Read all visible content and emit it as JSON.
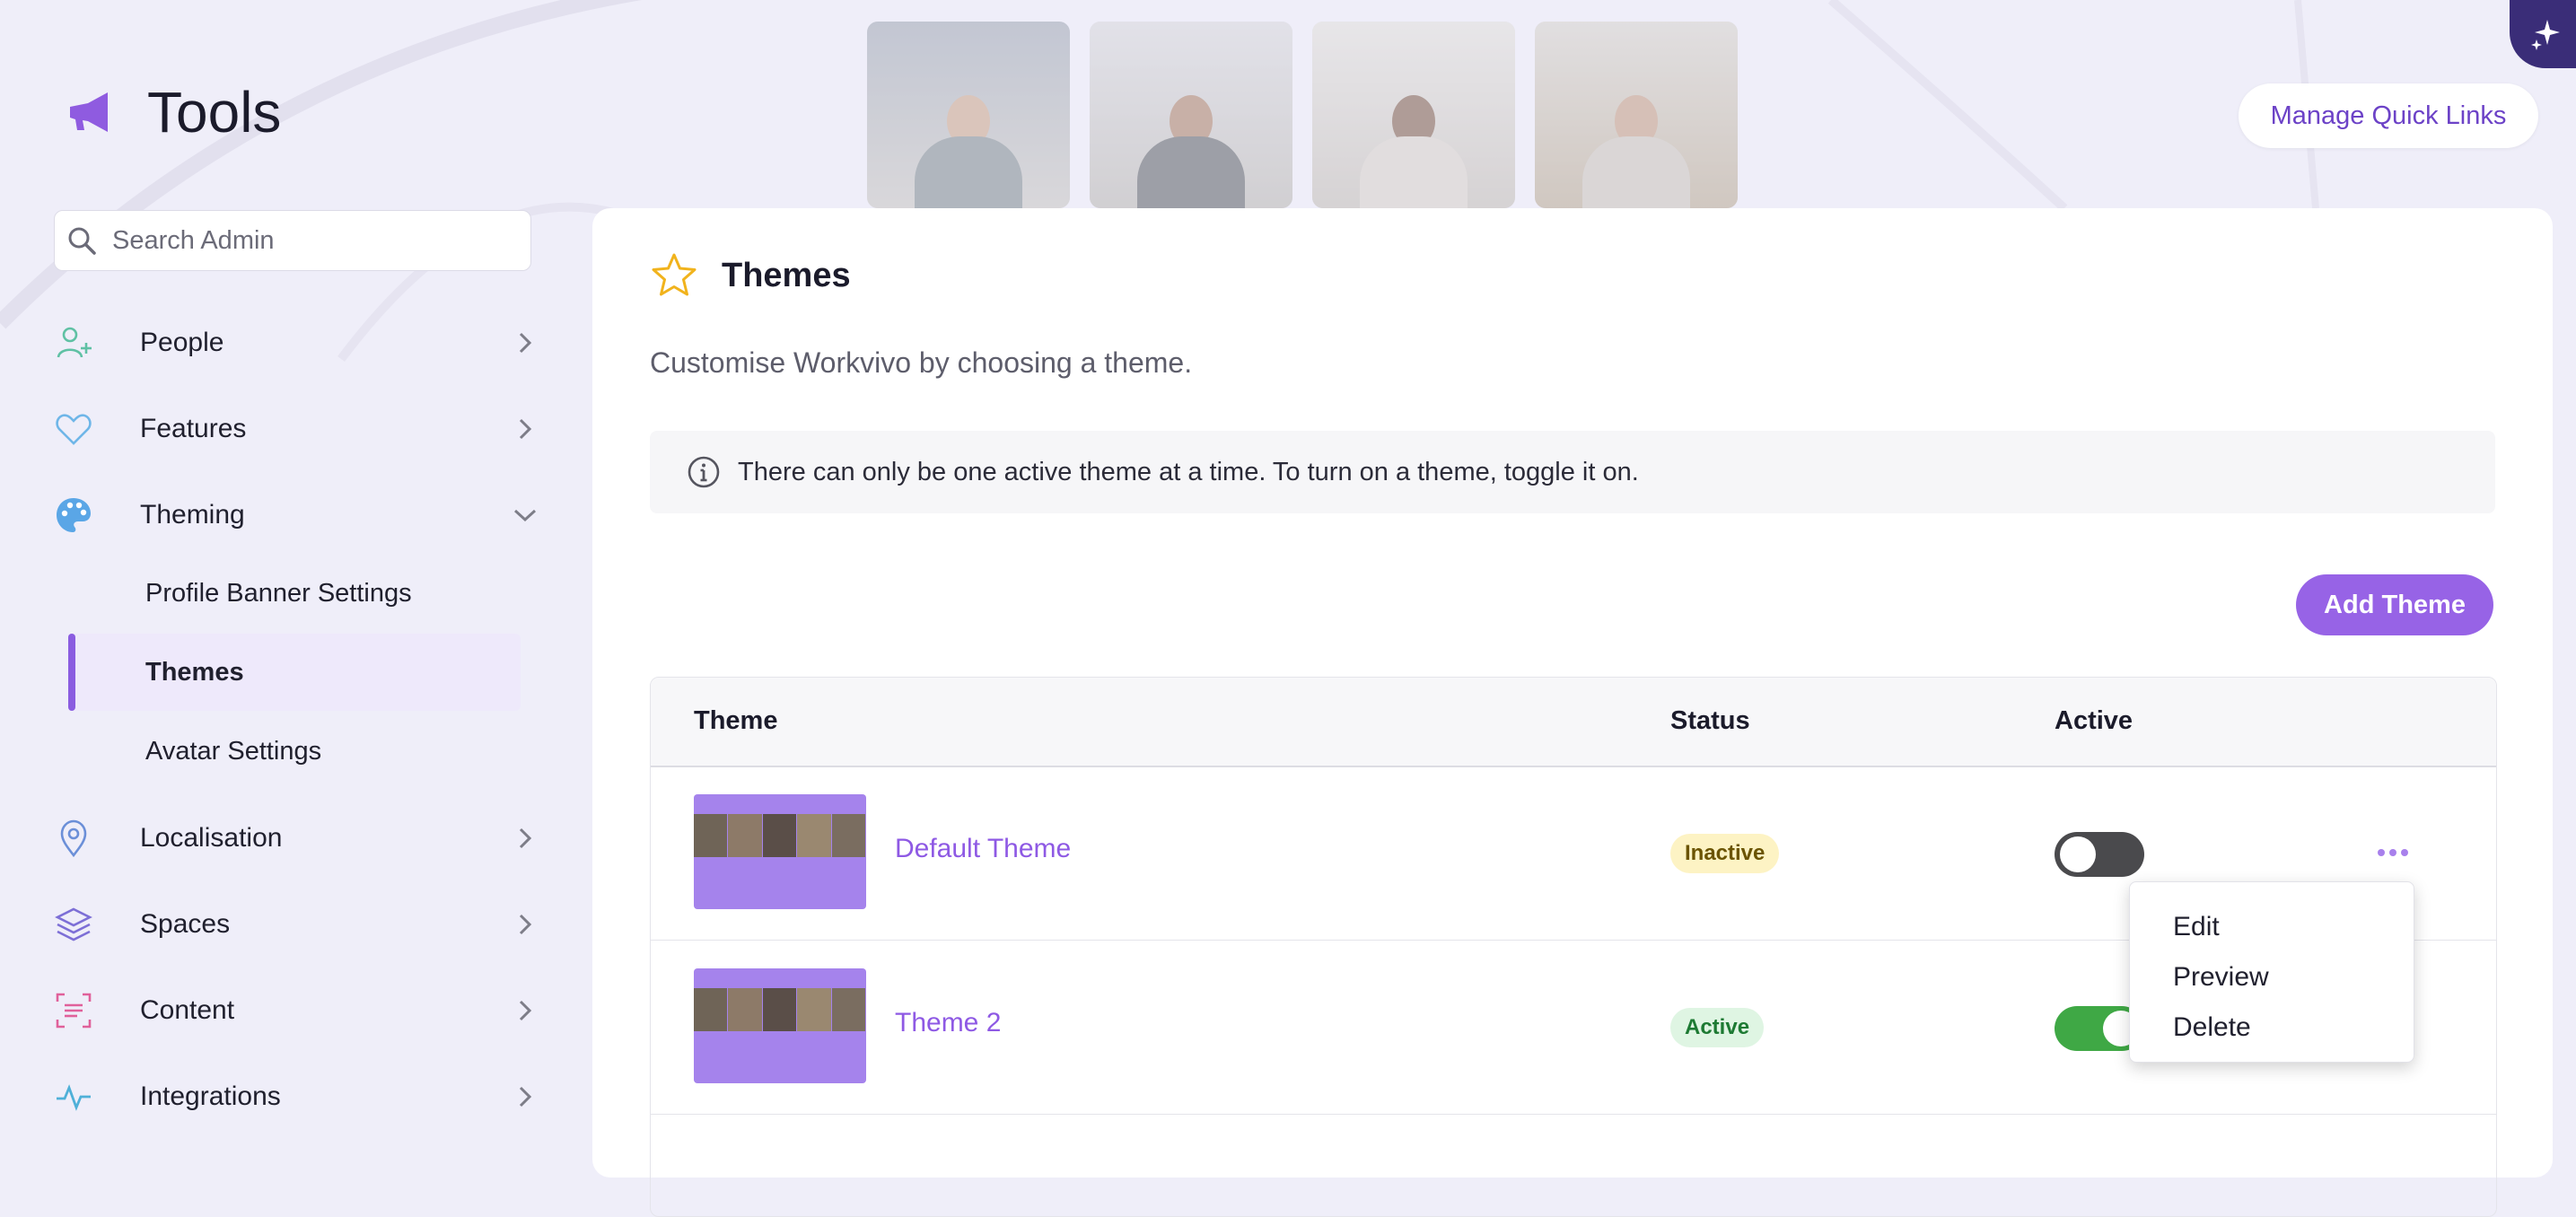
{
  "header": {
    "title": "Tools",
    "quick_links_label": "Manage Quick Links",
    "photos": [
      "photo-1",
      "photo-2",
      "photo-3",
      "photo-4"
    ]
  },
  "sidebar": {
    "search_placeholder": "Search Admin",
    "items": [
      {
        "label": "People",
        "icon": "person-add-icon",
        "expanded": false
      },
      {
        "label": "Features",
        "icon": "heart-icon",
        "expanded": false
      },
      {
        "label": "Theming",
        "icon": "palette-icon",
        "expanded": true
      },
      {
        "label": "Localisation",
        "icon": "location-pin-icon",
        "expanded": false
      },
      {
        "label": "Spaces",
        "icon": "layers-icon",
        "expanded": false
      },
      {
        "label": "Content",
        "icon": "scan-text-icon",
        "expanded": false
      },
      {
        "label": "Integrations",
        "icon": "activity-icon",
        "expanded": false
      }
    ],
    "theming_subitems": [
      {
        "label": "Profile Banner Settings",
        "selected": false
      },
      {
        "label": "Themes",
        "selected": true
      },
      {
        "label": "Avatar Settings",
        "selected": false
      }
    ]
  },
  "main": {
    "title": "Themes",
    "description": "Customise Workvivo by choosing a theme.",
    "info": "There can only be one active theme at a time. To turn on a theme, toggle it on.",
    "add_button": "Add Theme",
    "table": {
      "columns": [
        "Theme",
        "Status",
        "Active"
      ],
      "rows": [
        {
          "name": "Default Theme",
          "status": "Inactive",
          "active": false
        },
        {
          "name": "Theme 2",
          "status": "Active",
          "active": true
        }
      ]
    },
    "context_menu": [
      "Edit",
      "Preview",
      "Delete"
    ]
  },
  "colors": {
    "accent": "#9763e6",
    "link": "#8e59e4",
    "background": "#efeef9",
    "toggle_on": "#3fa845",
    "toggle_off": "#4a4a4d"
  }
}
